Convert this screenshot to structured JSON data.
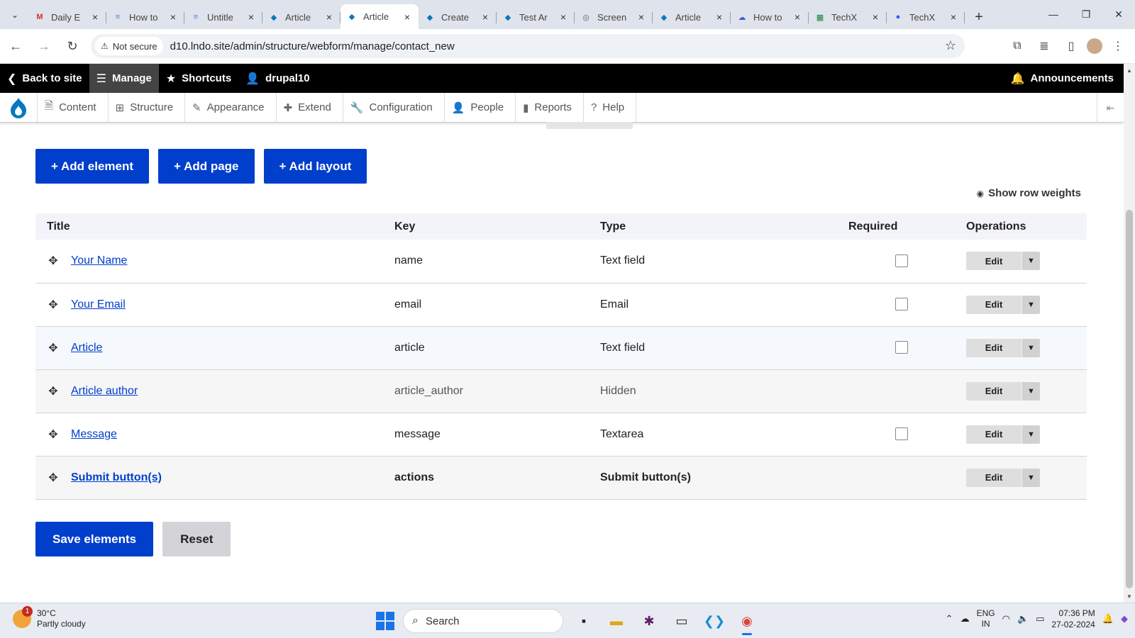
{
  "browser": {
    "tabs": [
      {
        "label": "Daily E",
        "icon": "gmail-icon",
        "color": "#d93025",
        "glyph": "M",
        "active": false
      },
      {
        "label": "How to",
        "icon": "docs-icon",
        "color": "#4285f4",
        "glyph": "≡",
        "active": false
      },
      {
        "label": "Untitle",
        "icon": "docs-icon",
        "color": "#4285f4",
        "glyph": "≡",
        "active": false
      },
      {
        "label": "Article",
        "icon": "drupal-icon",
        "color": "#0678be",
        "glyph": "◆",
        "active": false
      },
      {
        "label": "Article",
        "icon": "drupal-icon",
        "color": "#0678be",
        "glyph": "◆",
        "active": true
      },
      {
        "label": "Create",
        "icon": "drupal-icon",
        "color": "#0678be",
        "glyph": "◆",
        "active": false
      },
      {
        "label": "Test Ar",
        "icon": "drupal-icon",
        "color": "#0678be",
        "glyph": "◆",
        "active": false
      },
      {
        "label": "Screen",
        "icon": "camera-icon",
        "color": "#5f6368",
        "glyph": "◎",
        "active": false
      },
      {
        "label": "Article",
        "icon": "drupal-icon",
        "color": "#0678be",
        "glyph": "◆",
        "active": false
      },
      {
        "label": "How to",
        "icon": "cloud-icon",
        "color": "#3b5bdb",
        "glyph": "☁",
        "active": false
      },
      {
        "label": "TechX",
        "icon": "sheets-icon",
        "color": "#188038",
        "glyph": "▦",
        "active": false
      },
      {
        "label": "TechX",
        "icon": "zoom-icon",
        "color": "#2d5bff",
        "glyph": "●",
        "active": false
      }
    ],
    "security_label": "Not secure",
    "url": "d10.lndo.site/admin/structure/webform/manage/contact_new"
  },
  "toolbar": {
    "back_to_site": "Back to site",
    "manage": "Manage",
    "shortcuts": "Shortcuts",
    "user": "drupal10",
    "announcements": "Announcements"
  },
  "admin_menu": {
    "items": [
      {
        "label": "Content",
        "icon": "content-icon",
        "glyph": "🗎"
      },
      {
        "label": "Structure",
        "icon": "structure-icon",
        "glyph": "⊞"
      },
      {
        "label": "Appearance",
        "icon": "appearance-icon",
        "glyph": "✎"
      },
      {
        "label": "Extend",
        "icon": "extend-icon",
        "glyph": "✚"
      },
      {
        "label": "Configuration",
        "icon": "wrench-icon",
        "glyph": "🔧"
      },
      {
        "label": "People",
        "icon": "people-icon",
        "glyph": "👤"
      },
      {
        "label": "Reports",
        "icon": "reports-icon",
        "glyph": "▮"
      },
      {
        "label": "Help",
        "icon": "help-icon",
        "glyph": "?"
      }
    ]
  },
  "actions": {
    "add_element": "+ Add element",
    "add_page": "+ Add page",
    "add_layout": "+ Add layout",
    "show_row_weights": "Show row weights"
  },
  "table": {
    "headers": {
      "title": "Title",
      "key": "Key",
      "type": "Type",
      "required": "Required",
      "operations": "Operations"
    },
    "rows": [
      {
        "title": "Your Name",
        "key": "name",
        "type": "Text field",
        "required_checkbox": true,
        "edit": "Edit"
      },
      {
        "title": "Your Email",
        "key": "email",
        "type": "Email",
        "required_checkbox": true,
        "edit": "Edit"
      },
      {
        "title": "Article",
        "key": "article",
        "type": "Text field",
        "required_checkbox": true,
        "edit": "Edit"
      },
      {
        "title": "Article author",
        "key": "article_author",
        "type": "Hidden",
        "required_checkbox": false,
        "edit": "Edit"
      },
      {
        "title": "Message",
        "key": "message",
        "type": "Textarea",
        "required_checkbox": true,
        "edit": "Edit"
      },
      {
        "title": "Submit button(s)",
        "key": "actions",
        "type": "Submit button(s)",
        "required_checkbox": false,
        "edit": "Edit"
      }
    ]
  },
  "form": {
    "save": "Save elements",
    "reset": "Reset"
  },
  "taskbar": {
    "temperature": "30°C",
    "condition": "Partly cloudy",
    "weather_badge": "1",
    "search": "Search",
    "lang_top": "ENG",
    "lang_bottom": "IN",
    "time": "07:36 PM",
    "date": "27-02-2024"
  },
  "colors": {
    "primary": "#003ecc",
    "toolbar_bg": "#000000",
    "link": "#003ecc"
  }
}
